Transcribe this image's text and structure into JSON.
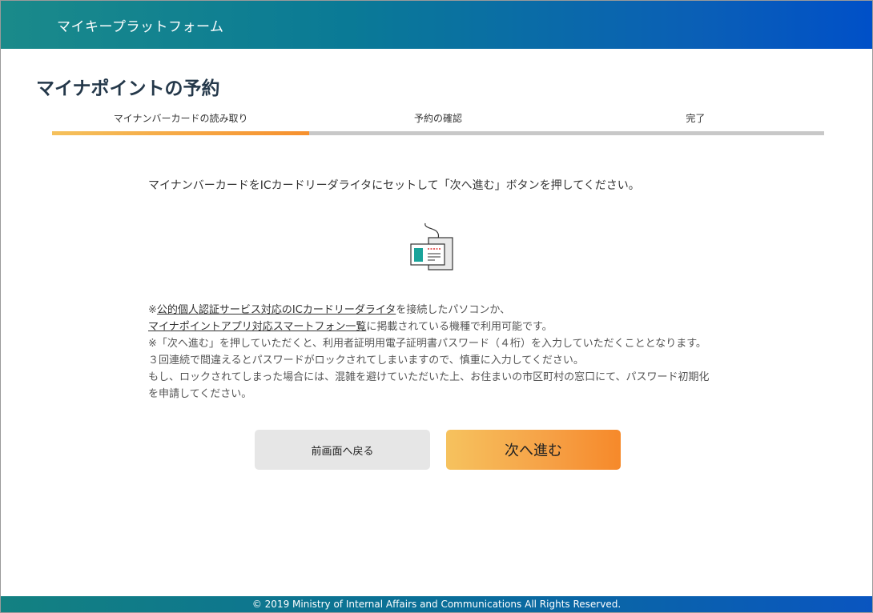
{
  "header": {
    "title": "マイキープラットフォーム"
  },
  "page": {
    "title": "マイナポイントの予約"
  },
  "steps": [
    {
      "label": "マイナンバーカードの読み取り",
      "active": true
    },
    {
      "label": "予約の確認",
      "active": false
    },
    {
      "label": "完了",
      "active": false
    }
  ],
  "instruction": "マイナンバーカードをICカードリーダライタにセットして「次へ進む」ボタンを押してください。",
  "notes": {
    "line1_prefix": "※",
    "line1_link": "公的個人認証サービス対応のICカードリーダライタ",
    "line1_suffix": "を接続したパソコンか、",
    "line2_link": "マイナポイントアプリ対応スマートフォン一覧",
    "line2_suffix": "に掲載されている機種で利用可能です。",
    "line3": "※「次へ進む」を押していただくと、利用者証明用電子証明書パスワード（４桁）を入力していただくこととなります。３回連続で間違えるとパスワードがロックされてしまいますので、慎重に入力してください。",
    "line4": "もし、ロックされてしまった場合には、混雑を避けていただいた上、お住まいの市区町村の窓口にて、パスワード初期化を申請してください。"
  },
  "buttons": {
    "back": "前画面へ戻る",
    "next": "次へ進む"
  },
  "footer": {
    "copyright": "© 2019 Ministry of Internal Affairs and Communications All Rights Reserved."
  },
  "colors": {
    "accent": "#f6902e",
    "header": "#0a5fb6",
    "card_teal": "#1aa39a"
  }
}
